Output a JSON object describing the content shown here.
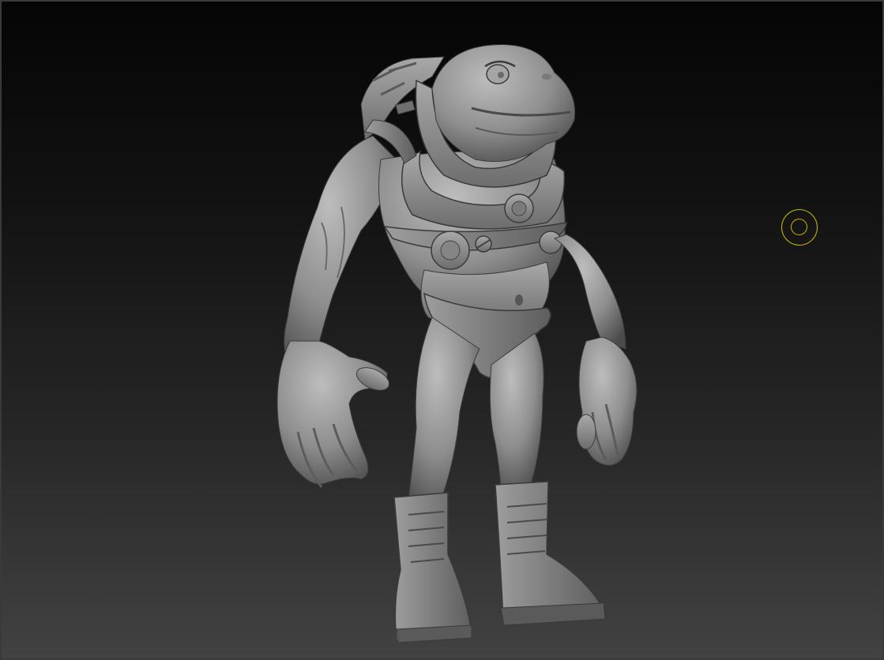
{
  "viewport": {
    "background_top": "#050505",
    "background_bottom": "#424242",
    "border_color": "#3a3a3a"
  },
  "model": {
    "icon": "frog-astronaut-sculpt",
    "material_color": "#8a8a8a"
  },
  "brush_cursor": {
    "icon": "brush-ring-cursor",
    "color": "#c9b800"
  }
}
